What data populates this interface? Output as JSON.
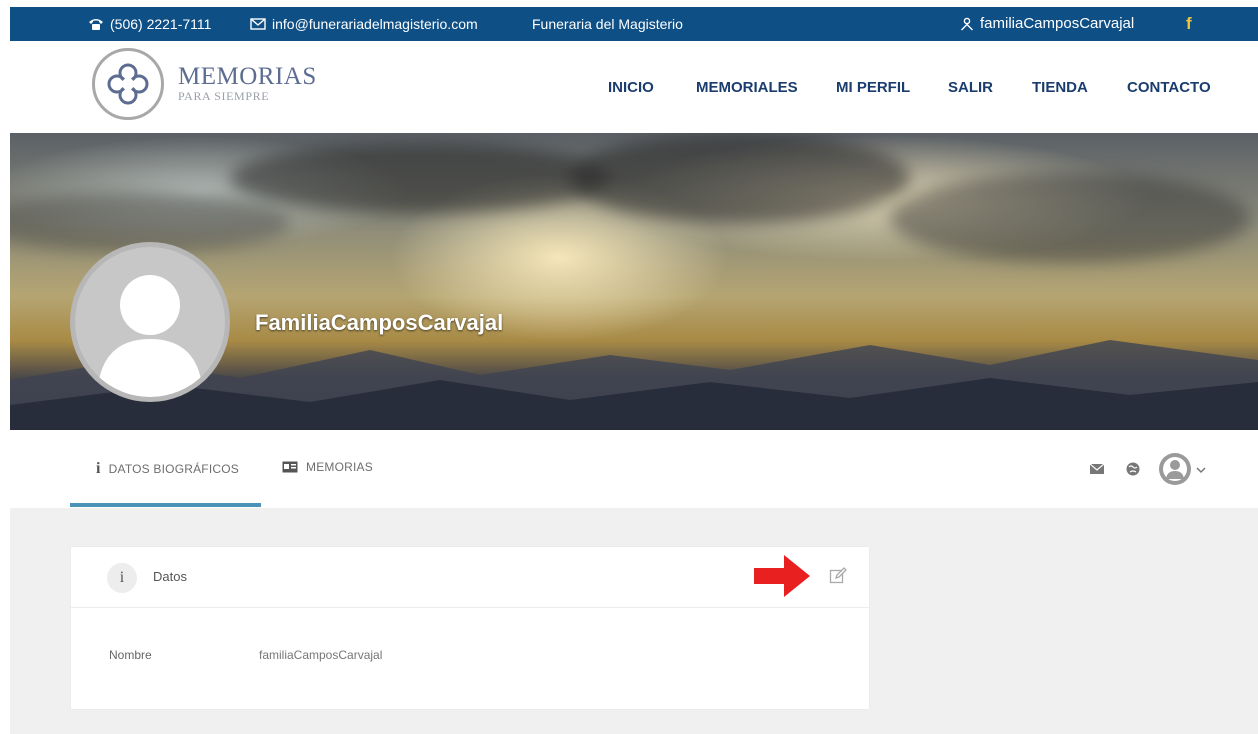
{
  "top_bar": {
    "phone": "(506) 2221-7111",
    "email": "info@funerariadelmagisterio.com",
    "company": "Funeraria del Magisterio",
    "user": "familiaCamposCarvajal",
    "facebook": "f",
    "icons": [
      "phone-icon",
      "mail-icon",
      "user-icon"
    ]
  },
  "brand": {
    "title": "MEMORIAS",
    "subtitle": "PARA SIEMPRE"
  },
  "nav": {
    "items": [
      {
        "label": "INICIO"
      },
      {
        "label": "MEMORIALES"
      },
      {
        "label": "MI PERFIL"
      },
      {
        "label": "SALIR"
      },
      {
        "label": "TIENDA"
      },
      {
        "label": "CONTACTO"
      }
    ]
  },
  "profile": {
    "display_name": "FamiliaCamposCarvajal"
  },
  "tabs": [
    {
      "label": "DATOS BIOGRÁFICOS",
      "icon": "info-icon",
      "active": true
    },
    {
      "label": "MEMORIAS",
      "icon": "card-icon",
      "active": false
    }
  ],
  "toolbar_icons": [
    "mail-icon",
    "globe-icon",
    "avatar-icon",
    "chevron-down-icon"
  ],
  "card": {
    "title": "Datos",
    "info_glyph": "i",
    "fields": [
      {
        "label": "Nombre",
        "value": "familiaCamposCarvajal"
      }
    ]
  },
  "colors": {
    "topbar": "#0e4f86",
    "nav_text": "#1b3d6e",
    "tab_accent": "#4a93b8",
    "annotation_arrow": "#e8201f"
  }
}
